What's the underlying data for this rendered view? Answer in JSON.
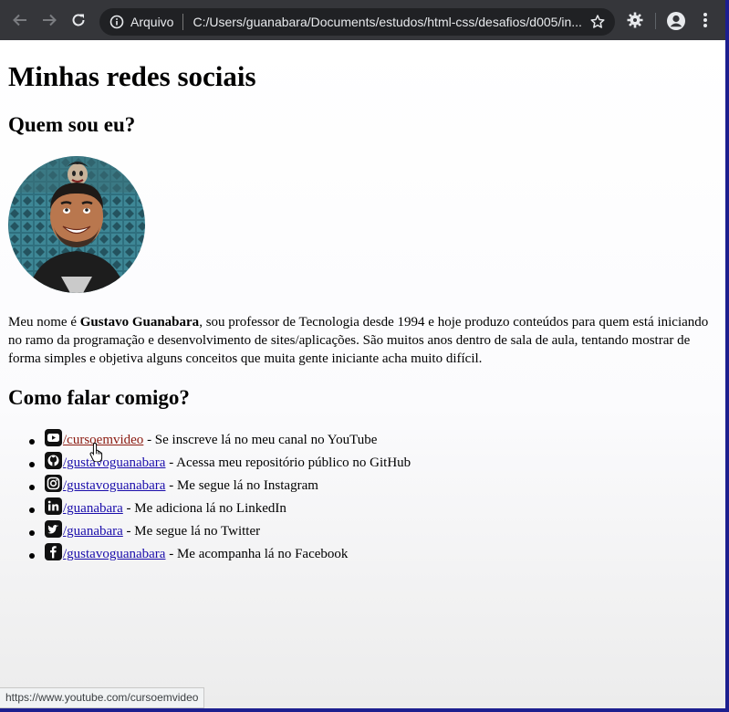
{
  "browser": {
    "site_info_label": "Arquivo",
    "url": "C:/Users/guanabara/Documents/estudos/html-css/desafios/d005/in...",
    "icons": {
      "back": "arrow-left-icon",
      "forward": "arrow-right-icon",
      "reload": "reload-icon",
      "info": "info-icon",
      "star": "star-icon",
      "extension": "extension-gear-icon",
      "profile": "account-icon",
      "menu": "kebab-menu-icon"
    }
  },
  "page": {
    "title": "Minhas redes sociais",
    "about_heading": "Quem sou eu?",
    "bio": {
      "prefix": "Meu nome é ",
      "name": "Gustavo Guanabara",
      "suffix": ", sou professor de Tecnologia desde 1994 e hoje produzo conteúdos para quem está iniciando no ramo da programação e desenvolvimento de sites/aplicações. São muitos anos dentro de sala de aula, tentando mostrar de forma simples e objetiva alguns conceitos que muita gente iniciante acha muito difícil."
    },
    "contact_heading": "Como falar comigo?",
    "social": [
      {
        "icon": "youtube-icon",
        "link": "/cursoemvideo",
        "desc": " - Se inscreve lá no meu canal no YouTube"
      },
      {
        "icon": "github-icon",
        "link": "/gustavoguanabara",
        "desc": " - Acessa meu repositório público no GitHub"
      },
      {
        "icon": "instagram-icon",
        "link": "/gustavoguanabara",
        "desc": " - Me segue lá no Instagram"
      },
      {
        "icon": "linkedin-icon",
        "link": "/guanabara",
        "desc": " - Me adiciona lá no LinkedIn"
      },
      {
        "icon": "twitter-icon",
        "link": "/guanabara",
        "desc": " - Me segue lá no Twitter"
      },
      {
        "icon": "facebook-icon",
        "link": "/gustavoguanabara",
        "desc": " - Me acompanha lá no Facebook"
      }
    ]
  },
  "status_bar": {
    "url": "https://www.youtube.com/cursoemvideo"
  },
  "colors": {
    "toolbar": "#35363a",
    "omnibox": "#202124",
    "link": "#1a0dab",
    "visited_link": "#8b1a10",
    "frame": "#1d1f8f"
  }
}
